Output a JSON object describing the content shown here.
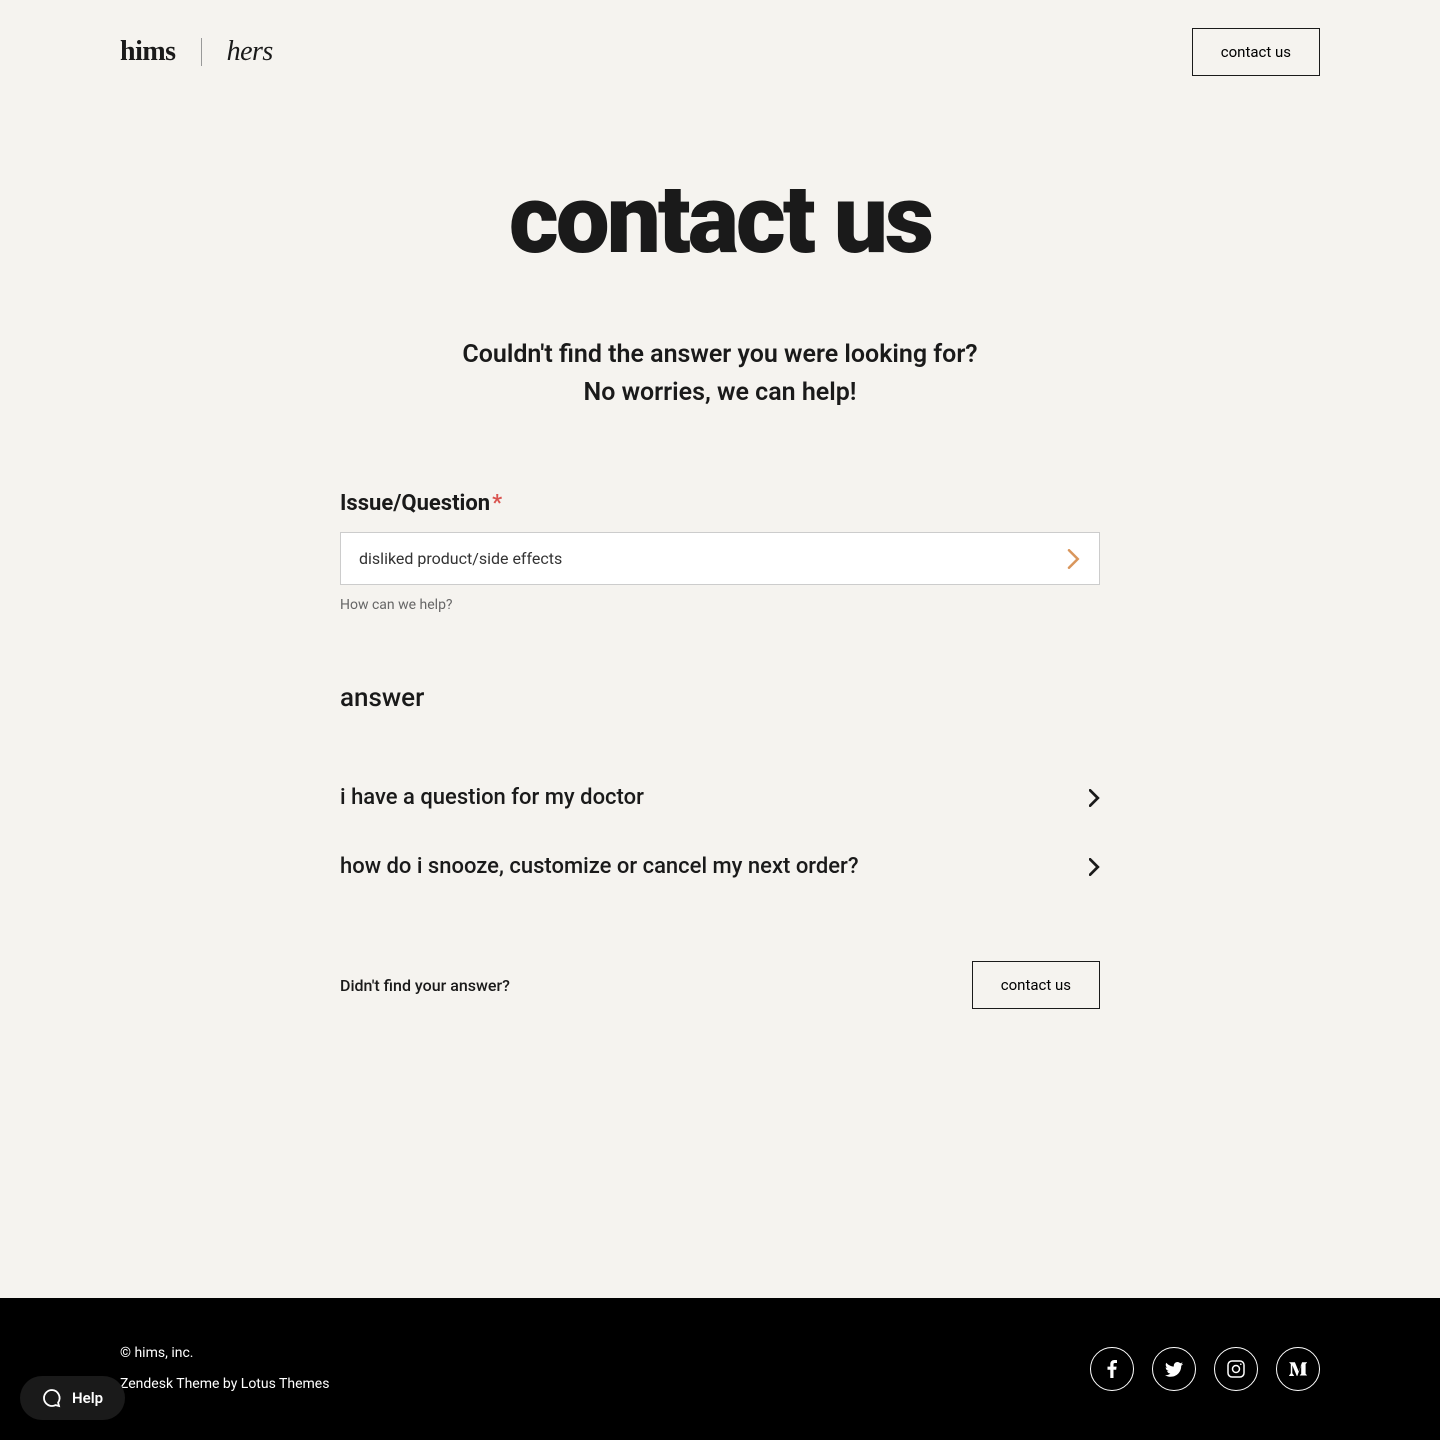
{
  "header": {
    "logo_hims": "hims",
    "logo_hers": "hers",
    "contact_button": "contact us"
  },
  "hero": {
    "title": "contact us",
    "subtitle_line1": "Couldn't find the answer you were looking for?",
    "subtitle_line2": "No worries, we can help!"
  },
  "form": {
    "label": "Issue/Question",
    "select_value": "disliked product/side effects",
    "helper_text": "How can we help?"
  },
  "answer": {
    "title": "answer",
    "items": [
      {
        "label": "i have a question for my doctor"
      },
      {
        "label": "how do i snooze, customize or cancel my next order?"
      }
    ],
    "footer_text": "Didn't find your answer?",
    "footer_button": "contact us"
  },
  "footer": {
    "copyright": "© hims, inc.",
    "theme_credit": "Zendesk Theme by Lotus Themes"
  },
  "help_widget": {
    "label": "Help"
  }
}
